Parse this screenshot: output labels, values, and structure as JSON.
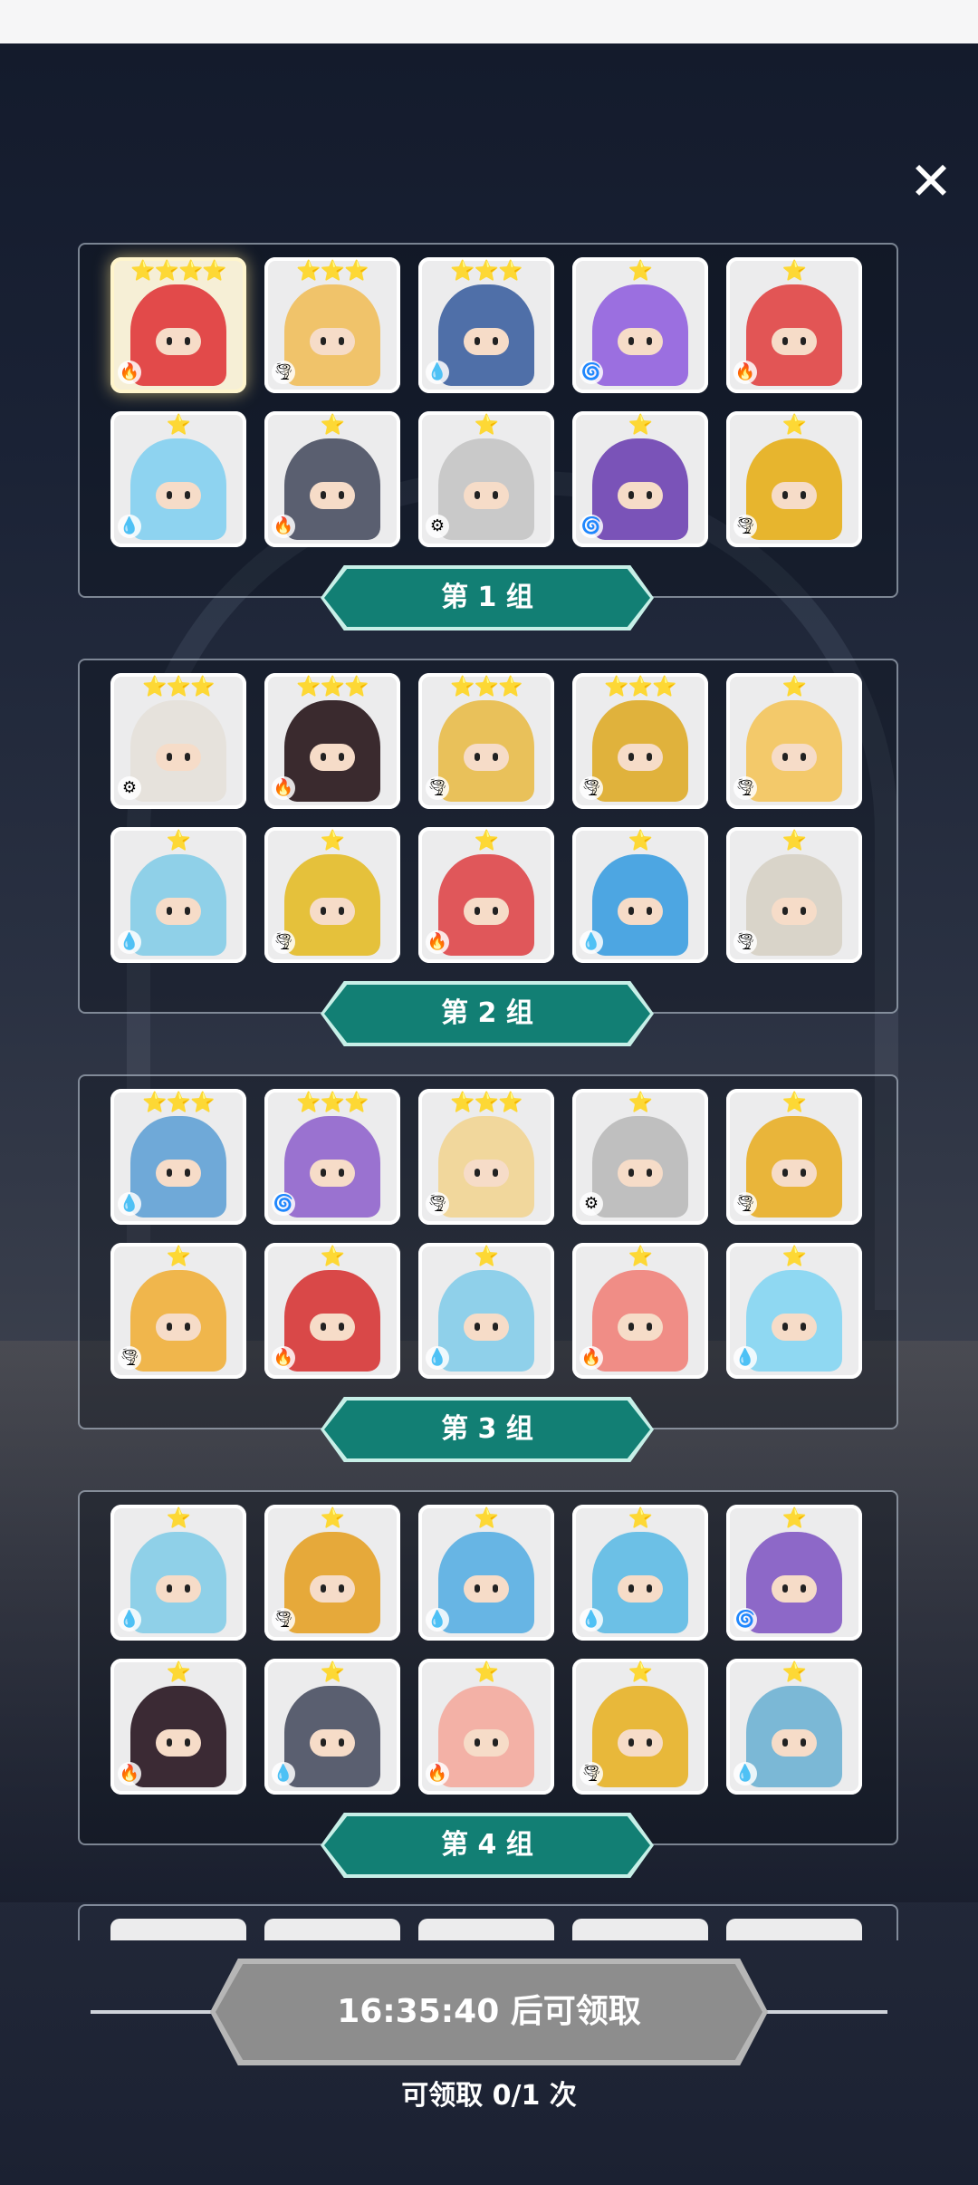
{
  "close_label": "✕",
  "claim": {
    "button_label": "16:35:40 后可领取",
    "count_label": "可领取 0/1 次"
  },
  "groups": [
    {
      "label": "第 1 组",
      "cards": [
        {
          "stars": "⭐⭐⭐⭐",
          "element": "fire",
          "color": "#e24a4a"
        },
        {
          "stars": "⭐⭐⭐",
          "element": "wind",
          "color": "#f0c36a"
        },
        {
          "stars": "⭐⭐⭐",
          "element": "water",
          "color": "#4f6fa8"
        },
        {
          "stars": "⭐",
          "element": "dark",
          "color": "#9b6fe0"
        },
        {
          "stars": "⭐",
          "element": "fire",
          "color": "#e25555"
        },
        {
          "stars": "⭐",
          "element": "water",
          "color": "#8ed3f0"
        },
        {
          "stars": "⭐",
          "element": "fire",
          "color": "#5a5f70"
        },
        {
          "stars": "⭐",
          "element": "light",
          "color": "#c9c9c9"
        },
        {
          "stars": "⭐",
          "element": "dark",
          "color": "#7a53b8"
        },
        {
          "stars": "⭐",
          "element": "wind",
          "color": "#e7b52e"
        }
      ]
    },
    {
      "label": "第 2 组",
      "cards": [
        {
          "stars": "⭐⭐⭐",
          "element": "light",
          "color": "#e6e2dc"
        },
        {
          "stars": "⭐⭐⭐",
          "element": "fire",
          "color": "#3a2a2e"
        },
        {
          "stars": "⭐⭐⭐",
          "element": "wind",
          "color": "#e9c15a"
        },
        {
          "stars": "⭐⭐⭐",
          "element": "wind",
          "color": "#e0b23c"
        },
        {
          "stars": "⭐",
          "element": "wind",
          "color": "#f3c96a"
        },
        {
          "stars": "⭐",
          "element": "water",
          "color": "#8fd0e8"
        },
        {
          "stars": "⭐",
          "element": "wind",
          "color": "#e5c13b"
        },
        {
          "stars": "⭐",
          "element": "fire",
          "color": "#e0575a"
        },
        {
          "stars": "⭐",
          "element": "water",
          "color": "#4da6e2"
        },
        {
          "stars": "⭐",
          "element": "wind",
          "color": "#d9d4c9"
        }
      ]
    },
    {
      "label": "第 3 组",
      "cards": [
        {
          "stars": "⭐⭐⭐",
          "element": "water",
          "color": "#6fa9d8"
        },
        {
          "stars": "⭐⭐⭐",
          "element": "dark",
          "color": "#9a72d0"
        },
        {
          "stars": "⭐⭐⭐",
          "element": "wind",
          "color": "#f1d79c"
        },
        {
          "stars": "⭐",
          "element": "light",
          "color": "#bfbfbf"
        },
        {
          "stars": "⭐",
          "element": "wind",
          "color": "#e9b53a"
        },
        {
          "stars": "⭐",
          "element": "wind",
          "color": "#f0b64c"
        },
        {
          "stars": "⭐",
          "element": "fire",
          "color": "#d94848"
        },
        {
          "stars": "⭐",
          "element": "water",
          "color": "#8fd0ea"
        },
        {
          "stars": "⭐",
          "element": "fire",
          "color": "#f08d86"
        },
        {
          "stars": "⭐",
          "element": "water",
          "color": "#8fd8f2"
        }
      ]
    },
    {
      "label": "第 4 组",
      "cards": [
        {
          "stars": "⭐",
          "element": "water",
          "color": "#8fd0e8"
        },
        {
          "stars": "⭐",
          "element": "wind",
          "color": "#e6a93a"
        },
        {
          "stars": "⭐",
          "element": "water",
          "color": "#67b5e4"
        },
        {
          "stars": "⭐",
          "element": "water",
          "color": "#6cc0e6"
        },
        {
          "stars": "⭐",
          "element": "dark",
          "color": "#8d68c8"
        },
        {
          "stars": "⭐",
          "element": "fire",
          "color": "#3b2a34"
        },
        {
          "stars": "⭐",
          "element": "water",
          "color": "#5a5f70"
        },
        {
          "stars": "⭐",
          "element": "fire",
          "color": "#f3b1a6"
        },
        {
          "stars": "⭐",
          "element": "wind",
          "color": "#e8b83a"
        },
        {
          "stars": "⭐",
          "element": "water",
          "color": "#7bb8d6"
        }
      ]
    }
  ]
}
